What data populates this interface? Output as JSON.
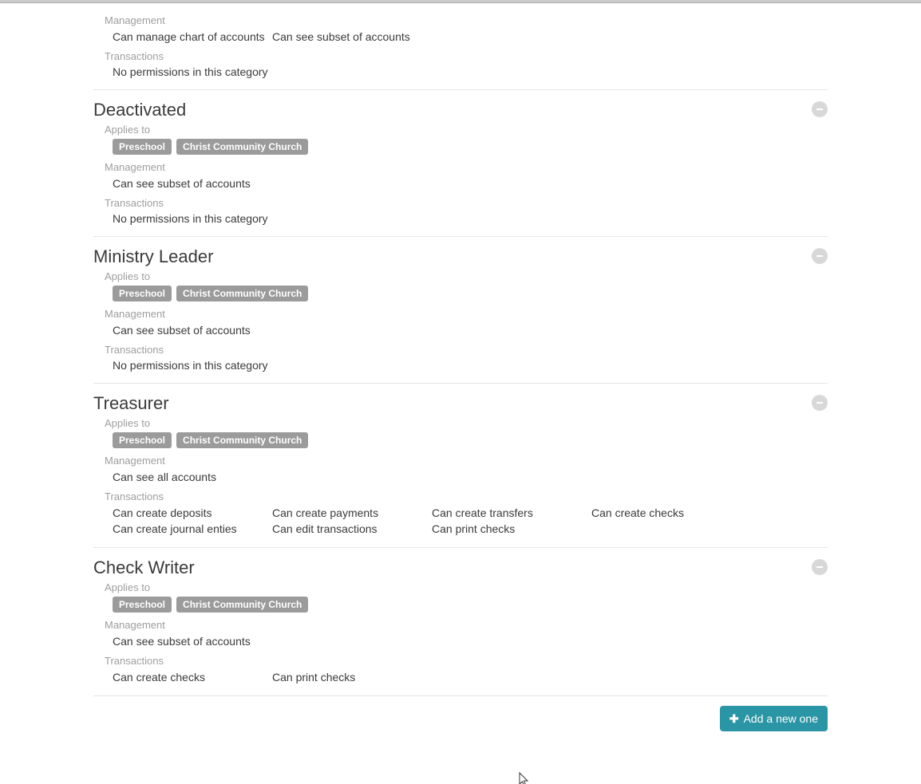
{
  "labels": {
    "applies_to": "Applies to",
    "management": "Management",
    "transactions": "Transactions",
    "no_permissions": "No permissions in this category",
    "add_new": "Add a new one"
  },
  "roles": [
    {
      "title": "",
      "show_title": false,
      "show_applies": false,
      "show_delete": false,
      "tags": [],
      "management": [
        "Can manage chart of accounts",
        "Can see subset of accounts"
      ],
      "transactions": []
    },
    {
      "title": "Deactivated",
      "show_title": true,
      "show_applies": true,
      "show_delete": true,
      "tags": [
        "Preschool",
        "Christ Community Church"
      ],
      "management": [
        "Can see subset of accounts"
      ],
      "transactions": []
    },
    {
      "title": "Ministry Leader",
      "show_title": true,
      "show_applies": true,
      "show_delete": true,
      "tags": [
        "Preschool",
        "Christ Community Church"
      ],
      "management": [
        "Can see subset of accounts"
      ],
      "transactions": []
    },
    {
      "title": "Treasurer",
      "show_title": true,
      "show_applies": true,
      "show_delete": true,
      "tags": [
        "Preschool",
        "Christ Community Church"
      ],
      "management": [
        "Can see all accounts"
      ],
      "transactions": [
        "Can create deposits",
        "Can create payments",
        "Can create transfers",
        "Can create checks",
        "Can create journal enties",
        "Can edit transactions",
        "Can print checks"
      ]
    },
    {
      "title": "Check Writer",
      "show_title": true,
      "show_applies": true,
      "show_delete": true,
      "tags": [
        "Preschool",
        "Christ Community Church"
      ],
      "management": [
        "Can see subset of accounts"
      ],
      "transactions": [
        "Can create checks",
        "Can print checks"
      ]
    }
  ]
}
